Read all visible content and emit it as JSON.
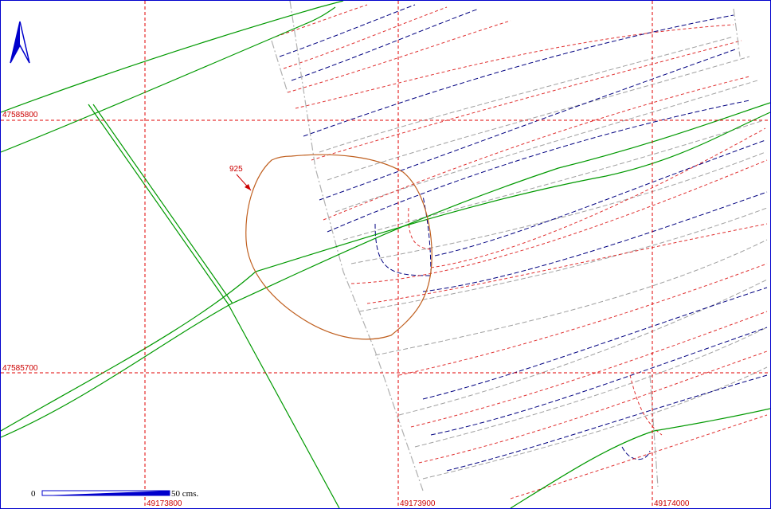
{
  "map": {
    "grid": {
      "x_labels": [
        "49173800",
        "49173900",
        "49174000"
      ],
      "y_labels": [
        "47585800",
        "47585700"
      ],
      "color": "#e00000"
    },
    "annotation": {
      "label": "925",
      "color": "#cc0000"
    },
    "scale_bar": {
      "start_label": "0",
      "end_label": "50 cms."
    },
    "north_arrow": {
      "icon": "north-arrow-icon"
    },
    "colors": {
      "road": "#009900",
      "contour_blue": "#000080",
      "contour_red": "#e03030",
      "contour_grey": "#a0a0a0",
      "boundary": "#b0b0b0",
      "pond": "#c06020",
      "frame": "#0000cc"
    }
  }
}
